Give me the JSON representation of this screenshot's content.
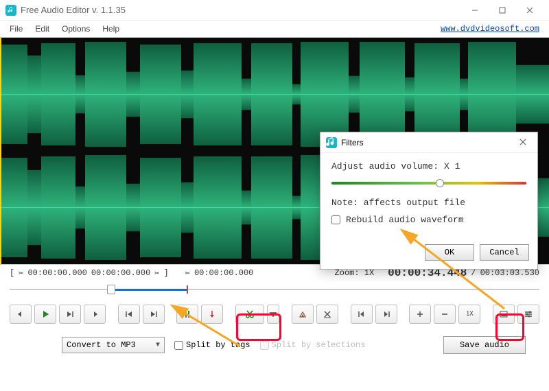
{
  "app": {
    "title": "Free Audio Editor v. 1.1.35",
    "site_link": "www.dvdvideosoft.com"
  },
  "menu": {
    "file": "File",
    "edit": "Edit",
    "options": "Options",
    "help": "Help"
  },
  "timebar": {
    "sel_start": "00:00:00.000",
    "sel_end": "00:00:00.000",
    "cursor": "00:00:00.000",
    "zoom_label": "Zoom: 1X",
    "position": "00:00:34.448",
    "total": "00:03:03.530",
    "sep": "/"
  },
  "toolbar": {
    "zoom_reset": "1X"
  },
  "bottom": {
    "convert_label": "Convert to MP3",
    "split_tags": "Split by tags",
    "split_selections": "Split by selections",
    "save": "Save audio"
  },
  "filters": {
    "title": "Filters",
    "volume_label": "Adjust audio volume:",
    "volume_value": "X 1",
    "note": "Note: affects output file",
    "rebuild": "Rebuild audio waveform",
    "ok": "OK",
    "cancel": "Cancel"
  }
}
